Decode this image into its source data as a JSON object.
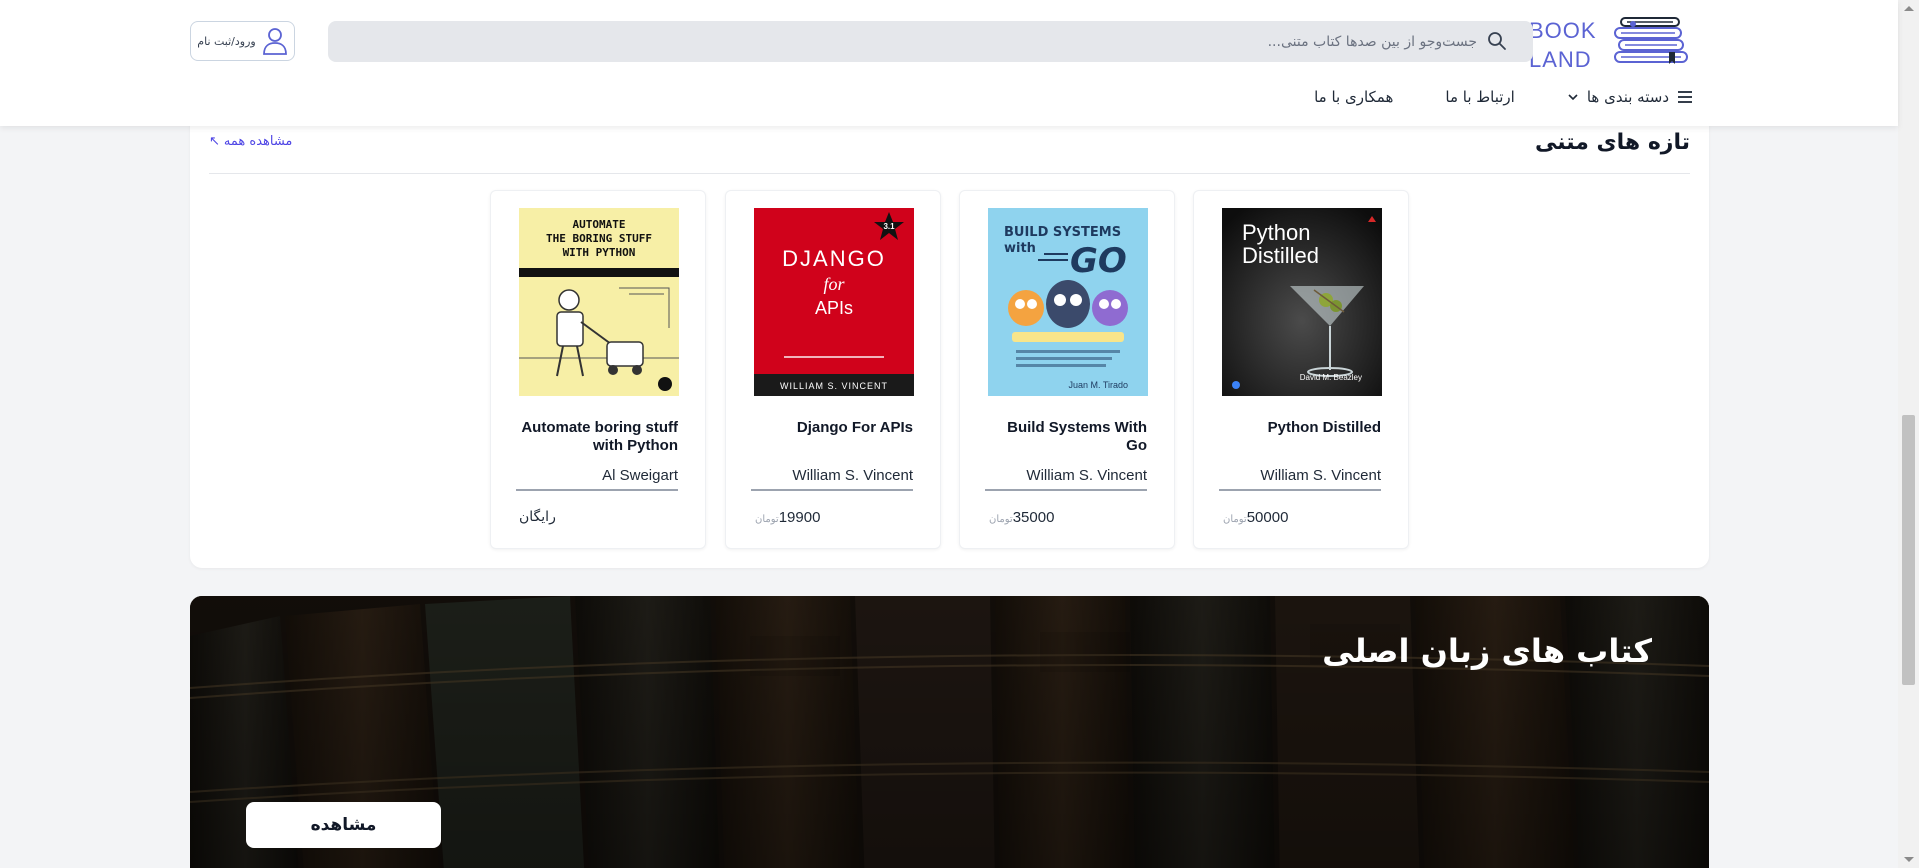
{
  "header": {
    "logo_line1": "BOOK",
    "logo_line2": "LAND",
    "search_placeholder": "جست‌وجو از بین صدها کتاب متنی...",
    "login_label": "ورود/ثبت نام",
    "nav": {
      "categories": "دسته بندی ها",
      "contact": "ارتباط با ما",
      "cooperation": "همکاری با ما"
    }
  },
  "new_text_books": {
    "title": "تازه های متنی",
    "view_all": "مشاهده همه",
    "books": [
      {
        "title": "Python Distilled",
        "author": "William S. Vincent",
        "price": "50000",
        "unit": "تومان",
        "cover_title_1": "Python",
        "cover_title_2": "Distilled",
        "cover_author": "David M. Beazley"
      },
      {
        "title": "Build Systems With Go",
        "author": "William S. Vincent",
        "price": "35000",
        "unit": "تومان",
        "cover_title_1": "BUILD SYSTEMS",
        "cover_title_2": "with",
        "cover_title_3": "GO",
        "cover_author": "Juan M. Tirado"
      },
      {
        "title": "Django For APIs",
        "author": "William S. Vincent",
        "price": "19900",
        "unit": "تومان",
        "cover_title_1": "DJANGO",
        "cover_title_2": "for",
        "cover_title_3": "APIs",
        "cover_badge": "3.1",
        "cover_author": "WILLIAM S. VINCENT"
      },
      {
        "title": "Automate boring stuff with Python",
        "author": "Al Sweigart",
        "price_text": "رایگان",
        "cover_title_1": "AUTOMATE",
        "cover_title_2": "THE BORING STUFF",
        "cover_title_3": "WITH PYTHON"
      }
    ]
  },
  "banner": {
    "title": "کتاب های زبان اصلی",
    "button": "مشاهده"
  },
  "colors": {
    "brand": "#5b63d3",
    "link": "#4f46e5",
    "page_bg": "#f3f4f6"
  }
}
